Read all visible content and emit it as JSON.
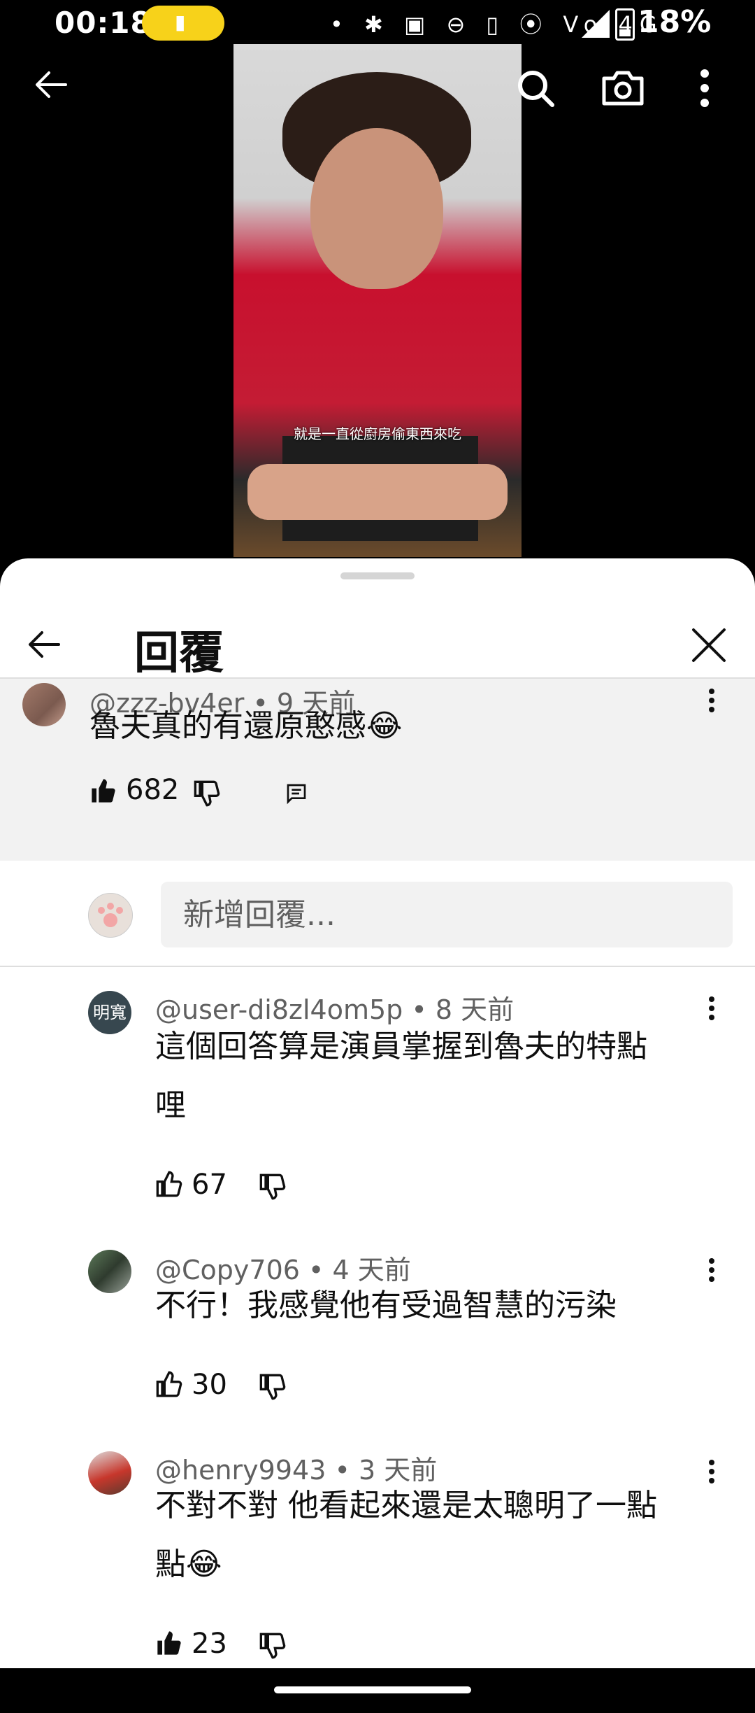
{
  "status_bar": {
    "time": "00:18",
    "icons_text": "• ✱ ▣ ⊖ ▯ ⦿ Vo 4G",
    "battery_pct": "18%"
  },
  "video": {
    "subtitle": "就是一直從廚房偷東西來吃"
  },
  "sheet": {
    "title": "回覆"
  },
  "parent_comment": {
    "author": "@zzz-bv4er",
    "age": "• 9 天前",
    "text": "魯夫真的有還原憨感😂",
    "likes": "682"
  },
  "reply_box": {
    "placeholder": "新增回覆..."
  },
  "replies": [
    {
      "avatar_text": "明寬",
      "author": "@user-di8zl4om5p",
      "age": "• 8 天前",
      "text_line1": "這個回答算是演員掌握到魯夫的特點",
      "text_line2": "哩",
      "likes": "67"
    },
    {
      "author": "@Copy706",
      "age": "• 4 天前",
      "text_line1": "不行！我感覺他有受過智慧的污染",
      "likes": "30"
    },
    {
      "author": "@henry9943",
      "age": "• 3 天前",
      "text_line1": "不對不對 他看起來還是太聰明了一點",
      "text_line2": "點😂",
      "likes": "23"
    }
  ],
  "colors": {
    "sheet_bg": "#ffffff",
    "parent_bg": "#f2f2f2",
    "meta_text": "#606060",
    "battery_pill": "#f7d21a"
  }
}
